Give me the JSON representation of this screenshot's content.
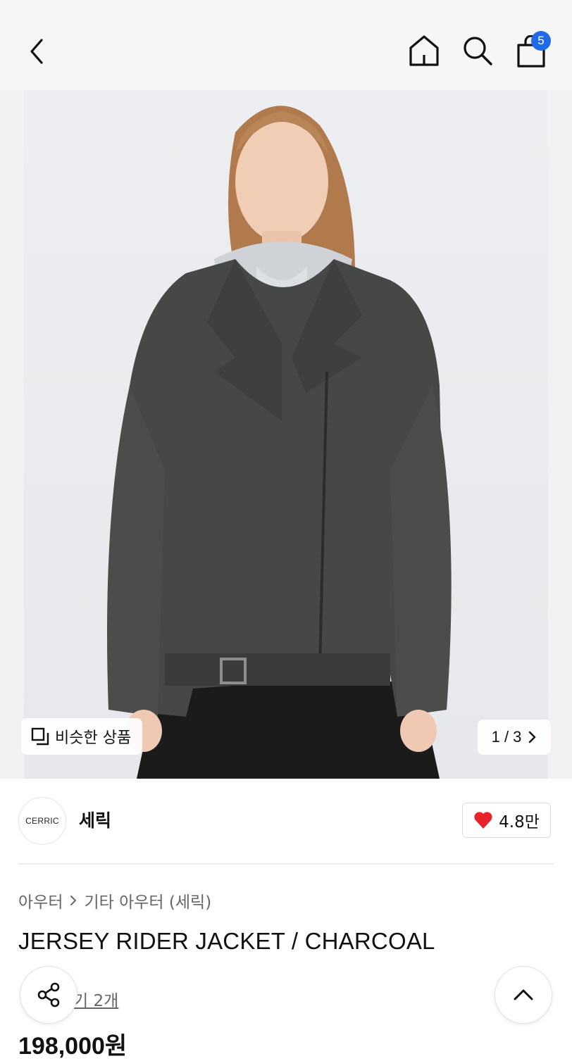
{
  "header": {
    "icons": [
      "chevron-left-icon",
      "home-icon",
      "search-icon",
      "shopping-bag-icon"
    ],
    "cart_count": "5",
    "badge_color": "#1f6ae6"
  },
  "gallery": {
    "similar_label": "비슷한 상품",
    "page_indicator": "1 / 3"
  },
  "brand": {
    "logo_text": "CERRIC",
    "name": "세릭",
    "likes": "4.8만",
    "heart_color": "#e8232a"
  },
  "product": {
    "breadcrumb": [
      "아우터",
      "기타 아우터 (세릭)"
    ],
    "title": "JERSEY RIDER JACKET / CHARCOAL",
    "review_link": "기 2개",
    "price": "198,000원"
  }
}
